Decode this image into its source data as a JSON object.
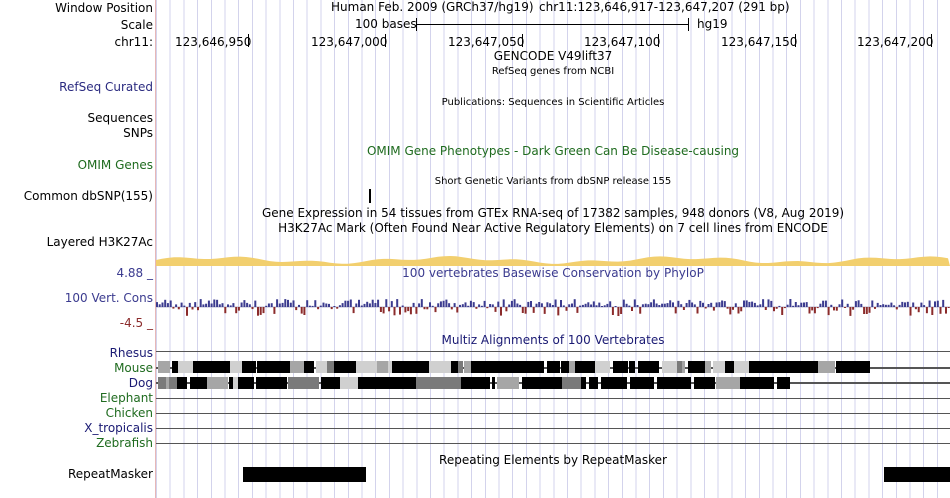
{
  "header": {
    "window_position_label": "Window Position",
    "assembly_text": "Human Feb. 2009 (GRCh37/hg19)",
    "position_text": "chr11:123,646,917-123,647,207 (291 bp)",
    "scale_label": "Scale",
    "scale_bar_text": "100 bases",
    "scale_db": "hg19",
    "chrom_label": "chr11:",
    "positions": [
      "123,646,950",
      "123,647,000",
      "123,647,050",
      "123,647,100",
      "123,647,150",
      "123,647,200"
    ]
  },
  "tracks": {
    "gencode_title": "GENCODE V49lift37",
    "refseq_subtitle": "RefSeq genes from NCBI",
    "refseq_label": "RefSeq Curated",
    "publications_title": "Publications: Sequences in Scientific Articles",
    "sequences_label": "Sequences",
    "snps_label": "SNPs",
    "omim_label": "OMIM Genes",
    "omim_title": "OMIM Gene Phenotypes - Dark Green Can Be Disease-causing",
    "dbsnp_title": "Short Genetic Variants from dbSNP release 155",
    "dbsnp_label": "Common dbSNP(155)",
    "gtex_title": "Gene Expression in 54 tissues from GTEx RNA-seq of 17382 samples, 948 donors (V8, Aug 2019)",
    "h3k27ac_title": "H3K27Ac Mark (Often Found Near Active Regulatory Elements) on 7 cell lines from ENCODE",
    "h3k27ac_label": "Layered H3K27Ac",
    "phylop_max": "4.88 _",
    "phylop_title": "100 vertebrates Basewise Conservation by PhyloP",
    "phylop_label": "100 Vert. Cons",
    "phylop_min": "-4.5 _",
    "multiz_title": "Multiz Alignments of 100 Vertebrates",
    "species": [
      {
        "name": "Rhesus",
        "color": "#1a1a73"
      },
      {
        "name": "Mouse",
        "color": "#1f6b1f"
      },
      {
        "name": "Dog",
        "color": "#1a1a73"
      },
      {
        "name": "Elephant",
        "color": "#1f6b1f"
      },
      {
        "name": "Chicken",
        "color": "#1f6b1f"
      },
      {
        "name": "X_tropicalis",
        "color": "#1a1a73"
      },
      {
        "name": "Zebrafish",
        "color": "#1f6b1f"
      }
    ],
    "repeat_title": "Repeating Elements by RepeatMasker",
    "repeat_label": "RepeatMasker"
  },
  "colors": {
    "refseq": "#2b2b80",
    "omim": "#1f6b1f",
    "phylop_pos": "#3b3b8f",
    "phylop_neg": "#8b2b2b",
    "phylop_scale_top": "#3b3b8f",
    "phylop_scale_bottom": "#8b2b2b",
    "h3k27ac": "#f2cf6e"
  }
}
